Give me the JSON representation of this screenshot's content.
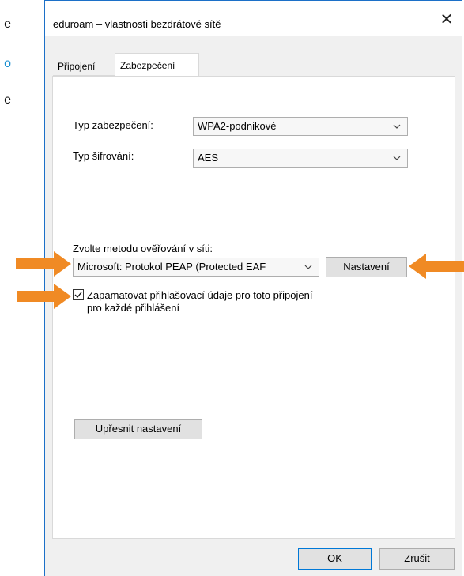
{
  "background_fragments": [
    {
      "text": "e",
      "color": "#111111"
    },
    {
      "text": "o",
      "color": "#1a8fd0"
    },
    {
      "text": "e",
      "color": "#111111"
    }
  ],
  "dialog": {
    "title": "eduroam – vlastnosti bezdrátové sítě",
    "close_glyph": "✕",
    "tabs": [
      {
        "label": "Připojení",
        "active": false
      },
      {
        "label": "Zabezpečení",
        "active": true
      }
    ],
    "security_type": {
      "label": "Typ zabezpečení:",
      "value": "WPA2-podnikové"
    },
    "encryption_type": {
      "label": "Typ šifrování:",
      "value": "AES"
    },
    "auth_method": {
      "label": "Zvolte metodu ověřování v síti:",
      "value": "Microsoft: Protokol PEAP (Protected EAF",
      "settings_button": "Nastavení"
    },
    "remember": {
      "checked": true,
      "label_line1": "Zapamatovat přihlašovací údaje pro toto připojení",
      "label_line2": "pro každé přihlášení"
    },
    "advanced_button": "Upřesnit nastavení",
    "ok_button": "OK",
    "cancel_button": "Zrušit"
  },
  "annotation_color": "#f08a24",
  "icons": {
    "dropdown": "chevron-down-icon",
    "check": "checkmark-icon",
    "close": "close-icon"
  }
}
